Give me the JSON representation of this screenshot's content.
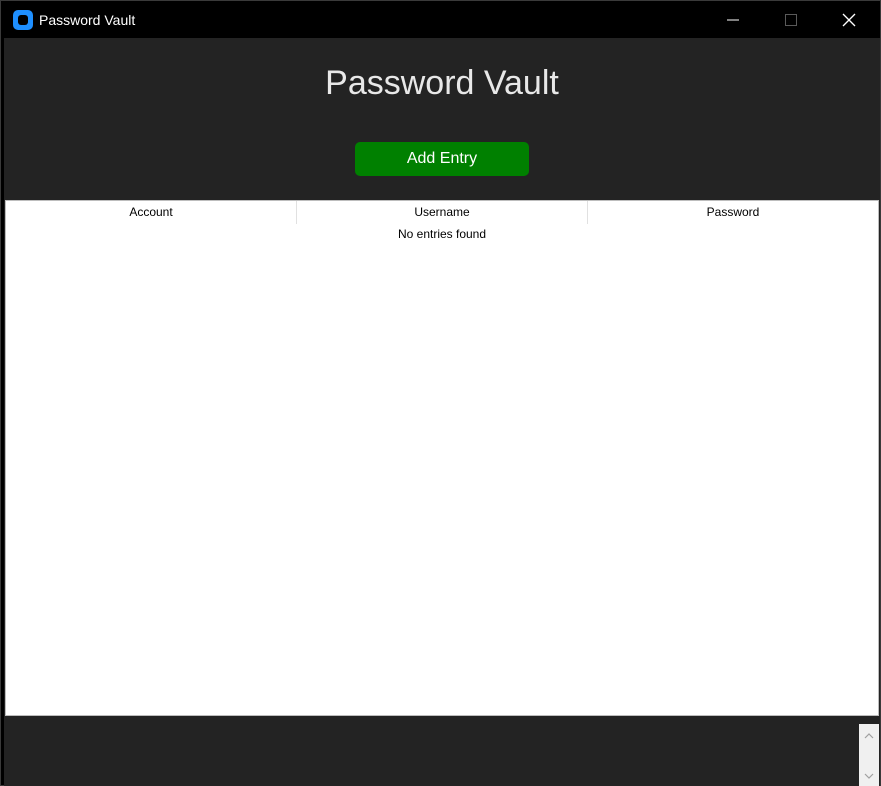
{
  "window": {
    "title": "Password Vault",
    "controls": {
      "minimize": "minimize",
      "maximize": "maximize",
      "close": "close"
    }
  },
  "main": {
    "heading": "Password Vault",
    "add_button_label": "Add Entry"
  },
  "table": {
    "columns": [
      "Account",
      "Username",
      "Password"
    ],
    "empty_message": "No entries found"
  },
  "colors": {
    "background": "#232323",
    "titlebar": "#000000",
    "accent_button": "#008000",
    "app_icon": "#1e8fff"
  },
  "icons": {
    "app": "app-icon",
    "minimize": "minimize-icon",
    "maximize": "maximize-icon",
    "close": "close-icon",
    "scroll_up": "chevron-up-icon",
    "scroll_down": "chevron-down-icon"
  }
}
